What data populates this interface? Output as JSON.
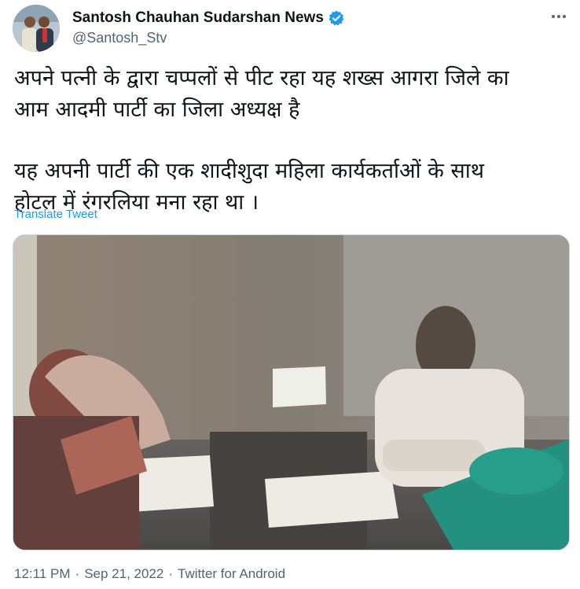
{
  "author": {
    "display_name": "Santosh Chauhan Sudarshan News",
    "handle": "@Santosh_Stv",
    "verified": true,
    "verified_color": "#1d9bf0"
  },
  "tweet": {
    "lines_para1": [
      "अपने पत्नी के द्वारा चप्पलों से पीट रहा यह शख्स आगरा जिले का",
      "आम आदमी पार्टी का जिला अध्यक्ष है"
    ],
    "lines_para2": [
      "यह अपनी पार्टी की एक शादीशुदा महिला कार्यकर्ताओं के साथ",
      "होटल में रंगरलिया मना रहा था ।"
    ],
    "translate_label": "Translate Tweet"
  },
  "meta": {
    "time": "12:11 PM",
    "separator": "·",
    "date": "Sep 21, 2022",
    "source": "Twitter for Android"
  },
  "colors": {
    "accent": "#1d9bf0",
    "secondary_text": "#536471"
  },
  "icons": {
    "verified": "verified-badge-icon",
    "more": "more-options-icon"
  }
}
